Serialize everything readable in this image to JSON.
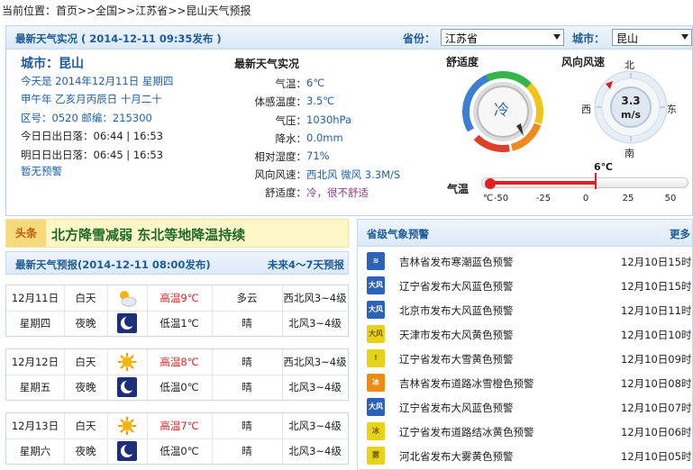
{
  "breadcrumb": {
    "prefix": "当前位置：",
    "items": [
      "首页",
      "全国",
      "江苏省",
      "昆山天气预报"
    ],
    "sep": ">>"
  },
  "now_panel": {
    "title": "最新天气实况 ( 2014-12-11  09:35发布 )",
    "province_label": "省份：",
    "province_value": "江苏省",
    "city_label": "城市：",
    "city_value": "昆山",
    "city_line": "城市：昆山",
    "date_line": "今天是 2014年12月11日 星期四",
    "lunar_line": "甲午年  乙亥月丙辰日  十月二十",
    "code_line": "区号：0520  邮编：215300",
    "sun_today": "今日日出日落：06:44 | 16:53",
    "sun_tomorrow": "明日日出日落：06:45 | 16:53",
    "alert_line": "暂无预警",
    "realtime_title": "最新天气实况",
    "realtime": [
      {
        "label": "气温：",
        "value": "6℃"
      },
      {
        "label": "体感温度：",
        "value": "3.5℃"
      },
      {
        "label": "气压：",
        "value": "1030hPa"
      },
      {
        "label": "降水：",
        "value": "0.0mm"
      },
      {
        "label": "相对湿度：",
        "value": "71%"
      },
      {
        "label": "风向风速：",
        "value": "西北风 微风 3.3M/S"
      },
      {
        "label": "舒适度：",
        "value": "冷，很不舒适"
      }
    ],
    "comfort_title": "舒适度",
    "comfort_value": "冷",
    "wind_title": "风向风速",
    "wind_value": "3.3",
    "wind_unit": "m/s",
    "compass": {
      "n": "北",
      "s": "南",
      "e": "东",
      "w": "西"
    },
    "temp_label": "气温",
    "temp_current": "6℃",
    "temp_value": 6,
    "temp_unit": "℃",
    "temp_ticks": [
      "-50",
      "-25",
      "0",
      "25",
      "50"
    ]
  },
  "headline": {
    "tag": "头条",
    "text": "北方降雪减弱  东北等地降温持续"
  },
  "forecast": {
    "title": "最新天气预报(2014-12-11  08:00发布)",
    "link": "未来4～7天预报",
    "days": [
      {
        "date": "12月11日",
        "weekday": "星期四",
        "day": {
          "label": "白天",
          "icon": "partly-cloudy-icon",
          "temp": "高温9℃",
          "weather": "多云",
          "wind": "西北风3~4级"
        },
        "night": {
          "label": "夜晚",
          "icon": "moon-icon",
          "temp": "低温1℃",
          "weather": "晴",
          "wind": "北风3~4级"
        }
      },
      {
        "date": "12月12日",
        "weekday": "星期五",
        "day": {
          "label": "白天",
          "icon": "sun-icon",
          "temp": "高温8℃",
          "weather": "晴",
          "wind": "西北风3~4级"
        },
        "night": {
          "label": "夜晚",
          "icon": "moon-icon",
          "temp": "低温0℃",
          "weather": "晴",
          "wind": "北风3~4级"
        }
      },
      {
        "date": "12月13日",
        "weekday": "星期六",
        "day": {
          "label": "白天",
          "icon": "sun-icon",
          "temp": "高温7℃",
          "weather": "晴",
          "wind": "北风3~4级"
        },
        "night": {
          "label": "夜晚",
          "icon": "moon-icon",
          "temp": "低温0℃",
          "weather": "晴",
          "wind": "北风3~4级"
        }
      }
    ]
  },
  "warnings": {
    "title": "省级气象预警",
    "more": "更多",
    "items": [
      {
        "text": "吉林省发布寒潮蓝色预警",
        "date": "12月10日15时",
        "color": "#2a63b8",
        "glyph": "≋"
      },
      {
        "text": "辽宁省发布大风蓝色预警",
        "date": "12月10日15时",
        "color": "#2a63b8",
        "glyph": "大风"
      },
      {
        "text": "北京市发布大风蓝色预警",
        "date": "12月10日11时",
        "color": "#2a63b8",
        "glyph": "大风"
      },
      {
        "text": "天津市发布大风黄色预警",
        "date": "12月10日10时",
        "color": "#e7d21a",
        "glyph": "大风"
      },
      {
        "text": "辽宁省发布大雪黄色预警",
        "date": "12月10日09时",
        "color": "#e7d21a",
        "glyph": "!"
      },
      {
        "text": "吉林省发布道路冰雪橙色预警",
        "date": "12月10日08时",
        "color": "#ef8a12",
        "glyph": "冰"
      },
      {
        "text": "辽宁省发布大风蓝色预警",
        "date": "12月10日07时",
        "color": "#2a63b8",
        "glyph": "大风"
      },
      {
        "text": "辽宁省发布道路结冰黄色预警",
        "date": "12月10日06时",
        "color": "#e7d21a",
        "glyph": "冰"
      },
      {
        "text": "河北省发布大雾黄色预警",
        "date": "12月10日05时",
        "color": "#e7d21a",
        "glyph": "雾"
      }
    ]
  }
}
